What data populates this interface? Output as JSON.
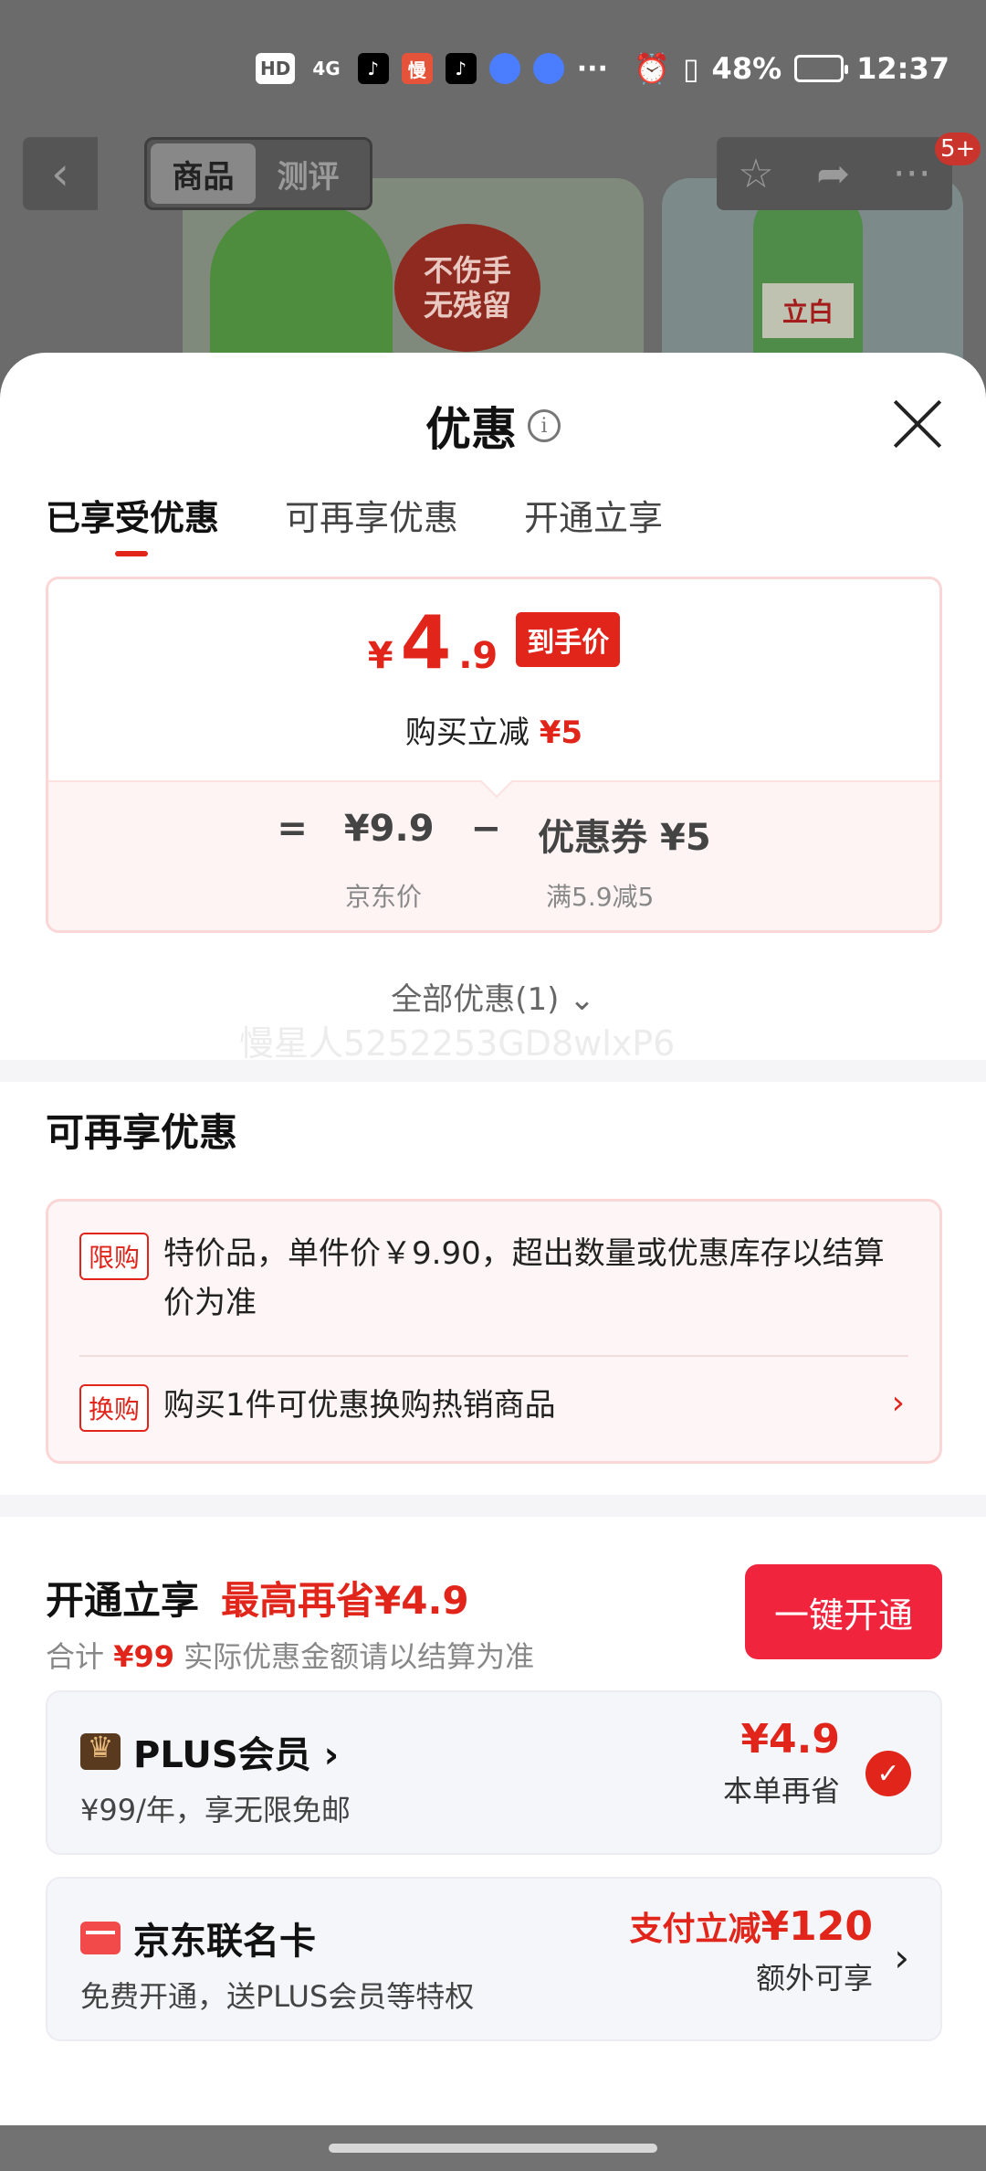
{
  "status_bar": {
    "hd": "HD",
    "network": "4G",
    "chip_man": "慢",
    "more": "···",
    "battery": "48%",
    "time": "12:37"
  },
  "product_header": {
    "tabs": [
      "商品",
      "测评"
    ],
    "badge_text_lines": [
      "不伤手",
      "无残留"
    ],
    "bottle_label": "立白",
    "message_count": "5+"
  },
  "sheet": {
    "title": "优惠",
    "tabs": [
      "已享受优惠",
      "可再享优惠",
      "开通立享"
    ],
    "deal": {
      "currency": "¥",
      "price_int": "4",
      "price_dec": ".9",
      "price_tag": "到手价",
      "buy_prefix": "购买立减",
      "buy_amount": "¥5",
      "eq": "=",
      "orig_price": "¥9.9",
      "minus": "−",
      "coupon": "优惠券 ¥5",
      "orig_label": "京东价",
      "coupon_label": "满5.9减5"
    },
    "all_deals": "全部优惠(1) ⌄",
    "watermark": "慢星人5252253GD8wlxP6",
    "more_deals": {
      "title": "可再享优惠",
      "items": [
        {
          "tag": "限购",
          "text": "特价品，单件价￥9.90，超出数量或优惠库存以结算价为准"
        },
        {
          "tag": "换购",
          "text": "购买1件可优惠换购热销商品"
        }
      ]
    },
    "open": {
      "title": "开通立享",
      "highlight": "最高再省¥4.9",
      "sub_prefix": "合计",
      "sub_amount": "¥99",
      "sub_suffix": "实际优惠金额请以结算为准",
      "button": "一键开通"
    },
    "plus_card": {
      "title": "PLUS会员 ›",
      "sub": "¥99/年，享无限免邮",
      "save": "¥4.9",
      "save_label": "本单再省"
    },
    "jd_card": {
      "title": "京东联名卡",
      "sub": "免费开通，送PLUS会员等特权",
      "offer_prefix": "支付立减",
      "offer_amount": "¥120",
      "offer_label": "额外可享"
    }
  },
  "colors": {
    "accent": "#e1251b",
    "button": "#f0243c",
    "card_pink_bg": "#fef6f6",
    "card_gray_bg": "#f5f6fa"
  }
}
